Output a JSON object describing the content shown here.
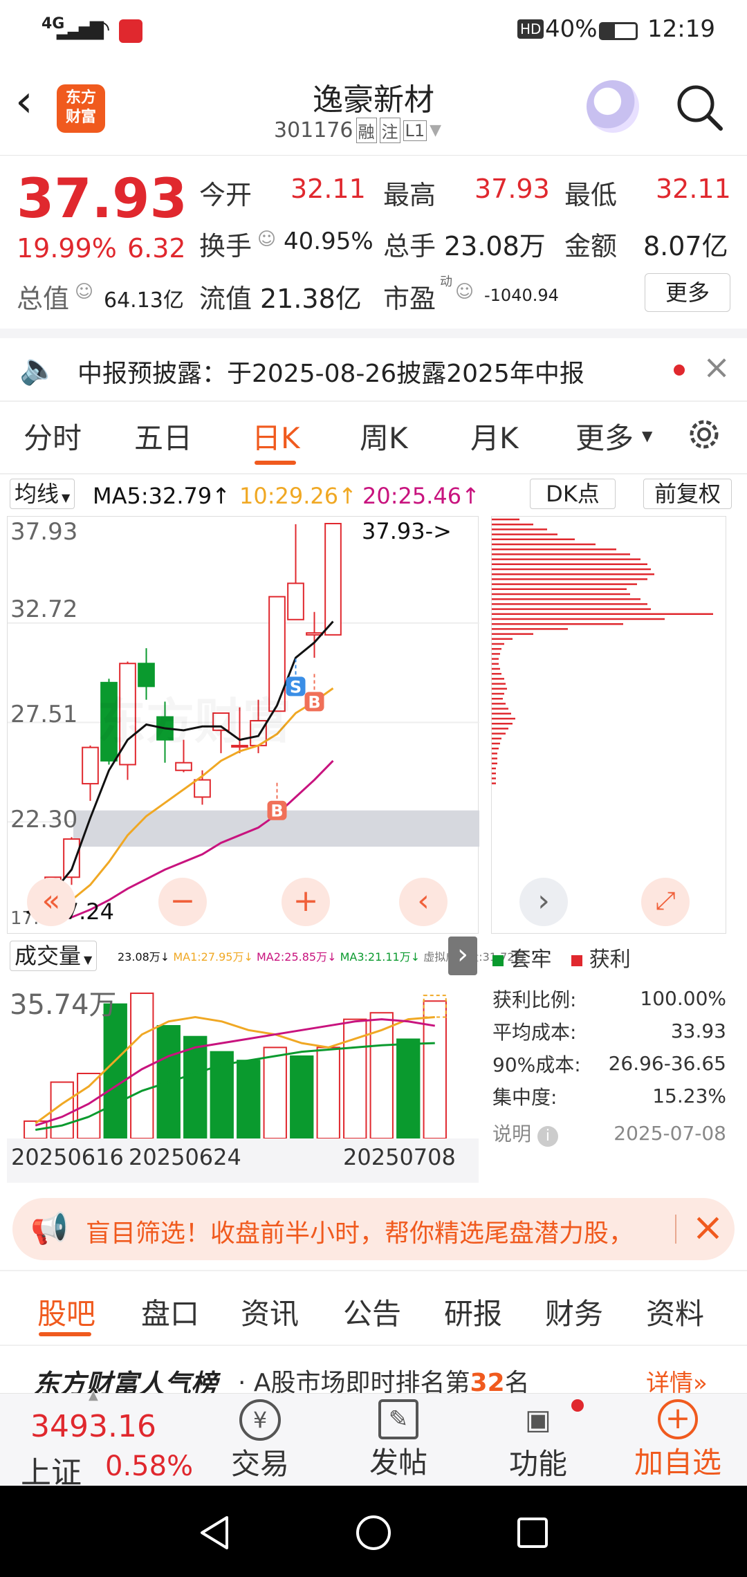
{
  "status_bar": {
    "signal": "4G",
    "battery": "40%",
    "time": "12:19",
    "hd": "HD"
  },
  "header": {
    "title": "逸豪新材",
    "code": "301176",
    "tags": [
      "融",
      "注",
      "L1"
    ],
    "logo_line1": "东方",
    "logo_line2": "财富"
  },
  "quote": {
    "price": "37.93",
    "pct": "19.99%",
    "chg": "6.32",
    "fields": {
      "open_label": "今开",
      "open": "32.11",
      "high_label": "最高",
      "high": "37.93",
      "low_label": "最低",
      "low": "32.11",
      "turnover_label": "换手",
      "turnover": "40.95%",
      "volume_label": "总手",
      "volume": "23.08万",
      "amount_label": "金额",
      "amount": "8.07亿",
      "mktcap_label": "总值",
      "mktcap": "64.13亿",
      "float_label": "流值",
      "float": "21.38亿",
      "pe_label": "市盈",
      "pe_sup": "动",
      "pe": "-1040.94"
    },
    "more_button": "更多"
  },
  "notice": {
    "text": "中报预披露：于2025-08-26披露2025年中报"
  },
  "ktabs": {
    "items": [
      "分时",
      "五日",
      "日K",
      "周K",
      "月K",
      "更多"
    ],
    "active": "日K"
  },
  "ma_bar": {
    "select": "均线",
    "ma5": "MA5:32.79",
    "ma10": "10:29.26",
    "ma20": "20:25.46",
    "dk": "DK点",
    "adjust": "前复权"
  },
  "kchart": {
    "y_ticks": [
      "37.93",
      "32.72",
      "27.51",
      "22.30",
      "17.09"
    ],
    "max_label": "37.93->",
    "min_label": "<-17.24",
    "badges": [
      "S",
      "B",
      "B"
    ]
  },
  "volume": {
    "select": "成交量",
    "ma_text": "23.08万↓ MA1:27.95万↓ MA2:25.85万↓ MA3:21.11万↓ 虚拟成交量:31.72万",
    "ma_text_parts": [
      "23.08万↓",
      "MA1:27.95万↓",
      "MA2:25.85万↓",
      "MA3:21.11万↓",
      "虚拟成交量:31.72万"
    ],
    "max_label": "35.74万",
    "dates": [
      "20250616",
      "20250624",
      "20250708"
    ]
  },
  "chip": {
    "legend_trap": "套牢",
    "legend_profit": "获利",
    "rows": [
      {
        "label": "获利比例:",
        "value": "100.00%"
      },
      {
        "label": "平均成本:",
        "value": "33.93"
      },
      {
        "label": "90%成本:",
        "value": "26.96-36.65"
      },
      {
        "label": "集中度:",
        "value": "15.23%"
      }
    ],
    "note_label": "说明",
    "note_date": "2025-07-08"
  },
  "banner": {
    "text": "盲目筛选！收盘前半小时，帮你精选尾盘潜力股，"
  },
  "bottom_tabs": {
    "items": [
      "股吧",
      "盘口",
      "资讯",
      "公告",
      "研报",
      "财务",
      "资料"
    ],
    "active": "股吧"
  },
  "popularity": {
    "title": "东方财富人气榜",
    "text": "· A股市场即时排名第",
    "rank": "32",
    "suffix": "名",
    "detail": "详情"
  },
  "index": {
    "value": "3493.16",
    "name": "上证",
    "pct": "0.58%"
  },
  "bottom_nav": [
    "交易",
    "发帖",
    "功能",
    "加自选"
  ],
  "colors": {
    "up": "#e0282e",
    "down": "#0a9a2e",
    "accent": "#f05a1e"
  },
  "chart_data": {
    "type": "candlestick",
    "candles": [
      {
        "o": 17.6,
        "h": 19.4,
        "l": 17.2,
        "c": 19.4,
        "up": true
      },
      {
        "o": 19.4,
        "h": 21.5,
        "l": 19.0,
        "c": 21.4,
        "up": true
      },
      {
        "o": 24.3,
        "h": 26.3,
        "l": 23.4,
        "c": 26.2,
        "up": true
      },
      {
        "o": 29.6,
        "h": 29.8,
        "l": 25.3,
        "c": 25.5,
        "up": false
      },
      {
        "o": 25.3,
        "h": 30.7,
        "l": 24.5,
        "c": 30.6,
        "up": true
      },
      {
        "o": 30.6,
        "h": 31.4,
        "l": 28.7,
        "c": 29.4,
        "up": false
      },
      {
        "o": 27.8,
        "h": 28.6,
        "l": 25.4,
        "c": 26.6,
        "up": false
      },
      {
        "o": 25.4,
        "h": 26.6,
        "l": 24.9,
        "c": 25.0,
        "up": true
      },
      {
        "o": 23.6,
        "h": 25.0,
        "l": 23.2,
        "c": 24.5,
        "up": true
      },
      {
        "o": 27.1,
        "h": 28.0,
        "l": 25.9,
        "c": 28.0,
        "up": true
      },
      {
        "o": 26.3,
        "h": 28.3,
        "l": 25.9,
        "c": 26.3,
        "up": true
      },
      {
        "o": 26.3,
        "h": 28.7,
        "l": 25.9,
        "c": 27.6,
        "up": true
      },
      {
        "o": 28.1,
        "h": 34.1,
        "l": 28.1,
        "c": 34.1,
        "up": true
      },
      {
        "o": 32.9,
        "h": 37.9,
        "l": 32.9,
        "c": 34.8,
        "up": true
      },
      {
        "o": 32.1,
        "h": 33.3,
        "l": 30.9,
        "c": 32.2,
        "up": true
      },
      {
        "o": 32.1,
        "h": 37.93,
        "l": 32.11,
        "c": 37.93,
        "up": true
      }
    ],
    "ma5": [
      18.6,
      19.8,
      22.5,
      25.0,
      26.6,
      27.4,
      27.2,
      27.1,
      27.3,
      27.3,
      26.6,
      26.8,
      28.4,
      30.9,
      31.7,
      32.8
    ],
    "ma10": [
      17.8,
      18.2,
      19.0,
      20.2,
      21.6,
      22.6,
      23.3,
      24.0,
      24.7,
      25.5,
      26.0,
      26.3,
      26.9,
      28.0,
      28.6,
      29.3
    ],
    "ma20": [
      17.1,
      17.3,
      17.7,
      18.2,
      18.8,
      19.3,
      19.8,
      20.2,
      20.6,
      21.2,
      21.6,
      22.0,
      22.7,
      23.6,
      24.5,
      25.5
    ],
    "volume": [
      4.0,
      13.0,
      15.0,
      31.0,
      33.5,
      26.0,
      23.5,
      20.0,
      18.0,
      21.0,
      19.0,
      21.0,
      27.5,
      29.0,
      22.9,
      31.7
    ],
    "volume_up": [
      true,
      true,
      true,
      false,
      true,
      false,
      false,
      false,
      false,
      true,
      false,
      true,
      true,
      true,
      false,
      true
    ],
    "ylim": [
      17.09,
      37.93
    ],
    "vol_max": 35.74
  }
}
